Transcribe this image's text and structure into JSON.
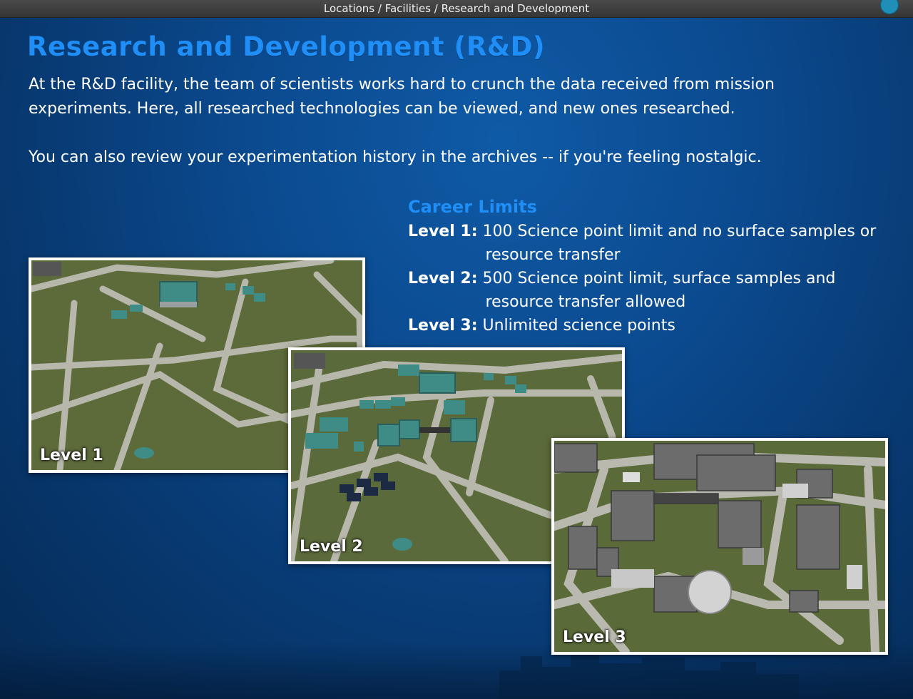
{
  "window": {
    "title": "Locations / Facilities / Research and Development"
  },
  "page": {
    "heading": "Research and Development (R&D)",
    "paragraph1": "At the R&D facility, the team of scientists works hard to crunch the data received from mission experiments. Here, all researched technologies can be viewed, and new ones researched.",
    "paragraph2": "You can also review your experimentation history in the archives -- if you're feeling nostalgic."
  },
  "career_limits": {
    "title": "Career Limits",
    "levels": [
      {
        "label": "Level 1:",
        "text": "100 Science point limit and no surface samples or resource transfer"
      },
      {
        "label": "Level 2:",
        "text": "500 Science point limit, surface samples and resource transfer allowed"
      },
      {
        "label": "Level 3:",
        "text": "Unlimited science points"
      }
    ]
  },
  "images": [
    {
      "caption": "Level 1",
      "icon": "facility-level-1-image"
    },
    {
      "caption": "Level 2",
      "icon": "facility-level-2-image"
    },
    {
      "caption": "Level 3",
      "icon": "facility-level-3-image"
    }
  ],
  "colors": {
    "accent_blue": "#1f8ef7",
    "background": "#0b4a8f",
    "grass": "#5b6638",
    "road": "#b4b4a8",
    "teal_roof": "#3f8c86"
  }
}
